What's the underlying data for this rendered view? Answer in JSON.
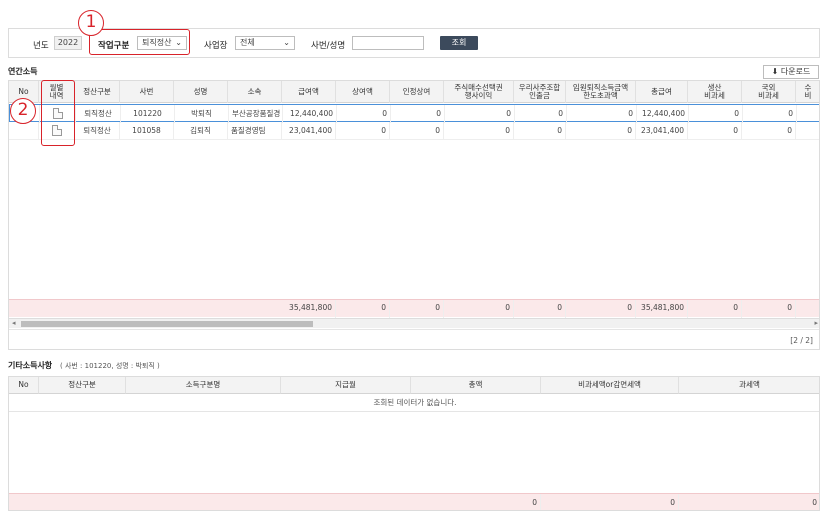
{
  "filter": {
    "year_label": "년도",
    "year_value": "2022",
    "work_type_label": "작업구분",
    "work_type_value": "퇴직정산",
    "site_label": "사업장",
    "site_value": "전체",
    "emp_label": "사번/성명",
    "emp_value": "",
    "search_button": "조회"
  },
  "annual": {
    "title": "연간소득",
    "download_button": "다운로드",
    "columns": [
      "No",
      "월별\n내역",
      "정산구분",
      "사번",
      "성명",
      "소속",
      "급여액",
      "상여액",
      "인정상여",
      "주식매수선택권\n행사이익",
      "우리사주조합\n인출금",
      "임원퇴직소득금액\n한도초과액",
      "총급여",
      "생산\n비과세",
      "국외\n비과세",
      "수\n비"
    ],
    "rows": [
      {
        "no": "",
        "type": "퇴직정산",
        "emp_no": "101220",
        "name": "박퇴직",
        "dept": "부산공장품질경",
        "salary": "12,440,400",
        "bonus": "0",
        "deemed": "0",
        "stock": "0",
        "esop": "0",
        "exec": "0",
        "total": "12,440,400",
        "prod": "0",
        "foreign": "0"
      },
      {
        "no": "",
        "type": "퇴직정산",
        "emp_no": "101058",
        "name": "김퇴직",
        "dept": "품질경영팀",
        "salary": "23,041,400",
        "bonus": "0",
        "deemed": "0",
        "stock": "0",
        "esop": "0",
        "exec": "0",
        "total": "23,041,400",
        "prod": "0",
        "foreign": "0"
      }
    ],
    "sum": {
      "salary": "35,481,800",
      "bonus": "0",
      "deemed": "0",
      "stock": "0",
      "esop": "0",
      "exec": "0",
      "total": "35,481,800",
      "prod": "0",
      "foreign": "0"
    },
    "pager": "[2 / 2]"
  },
  "other": {
    "title": "기타소득사항",
    "subtitle": "( 사번 : 101220, 성명 : 박퇴직 )",
    "columns": [
      "No",
      "정산구분",
      "소득구분명",
      "지급월",
      "총액",
      "비과세액or감면세액",
      "과세액"
    ],
    "empty_message": "조회된 데이터가 없습니다.",
    "sum": {
      "total": "0",
      "nontax": "0",
      "tax": "0"
    }
  },
  "callouts": {
    "one": "1",
    "two": "2"
  },
  "colors": {
    "accent": "#d8232a",
    "button": "#3c4a5c",
    "sum_bg": "#fbe9ea",
    "selected_border": "#4a90d9"
  }
}
